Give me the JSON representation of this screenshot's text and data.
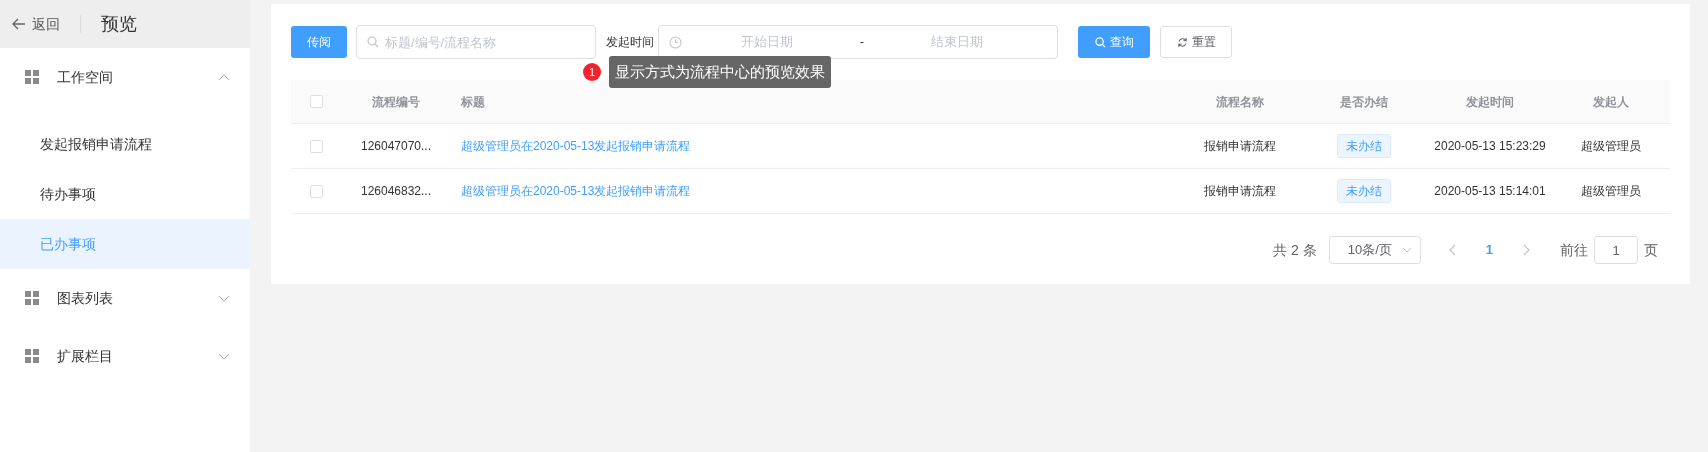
{
  "header": {
    "back": "返回",
    "title": "预览"
  },
  "sidebar": {
    "groups": [
      {
        "label": "工作空间",
        "expanded": true,
        "children": [
          {
            "label": "发起报销申请流程",
            "selected": false
          },
          {
            "label": "待办事项",
            "selected": false
          },
          {
            "label": "已办事项",
            "selected": true
          }
        ]
      },
      {
        "label": "图表列表",
        "expanded": false
      },
      {
        "label": "扩展栏目",
        "expanded": false
      }
    ]
  },
  "toolbar": {
    "circulate_button": "传阅",
    "search": {
      "placeholder": "标题/编号/流程名称"
    },
    "date_label": "发起时间",
    "date_range": {
      "start_placeholder": "开始日期",
      "separator": "-",
      "end_placeholder": "结束日期"
    },
    "query_button": "查询",
    "reset_button": "重置"
  },
  "tooltip": {
    "badge": "1",
    "text": "显示方式为流程中心的预览效果"
  },
  "table": {
    "select_all_checked": false,
    "columns": [
      "流程编号",
      "标题",
      "流程名称",
      "是否办结",
      "发起时间",
      "发起人"
    ],
    "rows": [
      {
        "checked": false,
        "id": "126047070...",
        "title": "超级管理员在2020-05-13发起报销申请流程",
        "process": "报销申请流程",
        "status": "未办结",
        "time": "2020-05-13 15:23:29",
        "initiator": "超级管理员"
      },
      {
        "checked": false,
        "id": "126046832...",
        "title": "超级管理员在2020-05-13发起报销申请流程",
        "process": "报销申请流程",
        "status": "未办结",
        "time": "2020-05-13 15:14:01",
        "initiator": "超级管理员"
      }
    ]
  },
  "pagination": {
    "total": "共 2 条",
    "page_size": "10条/页",
    "pages": [
      {
        "label": "1",
        "selected": true
      }
    ],
    "goto_label": "前往",
    "goto_value": "1",
    "page_suffix": "页"
  }
}
